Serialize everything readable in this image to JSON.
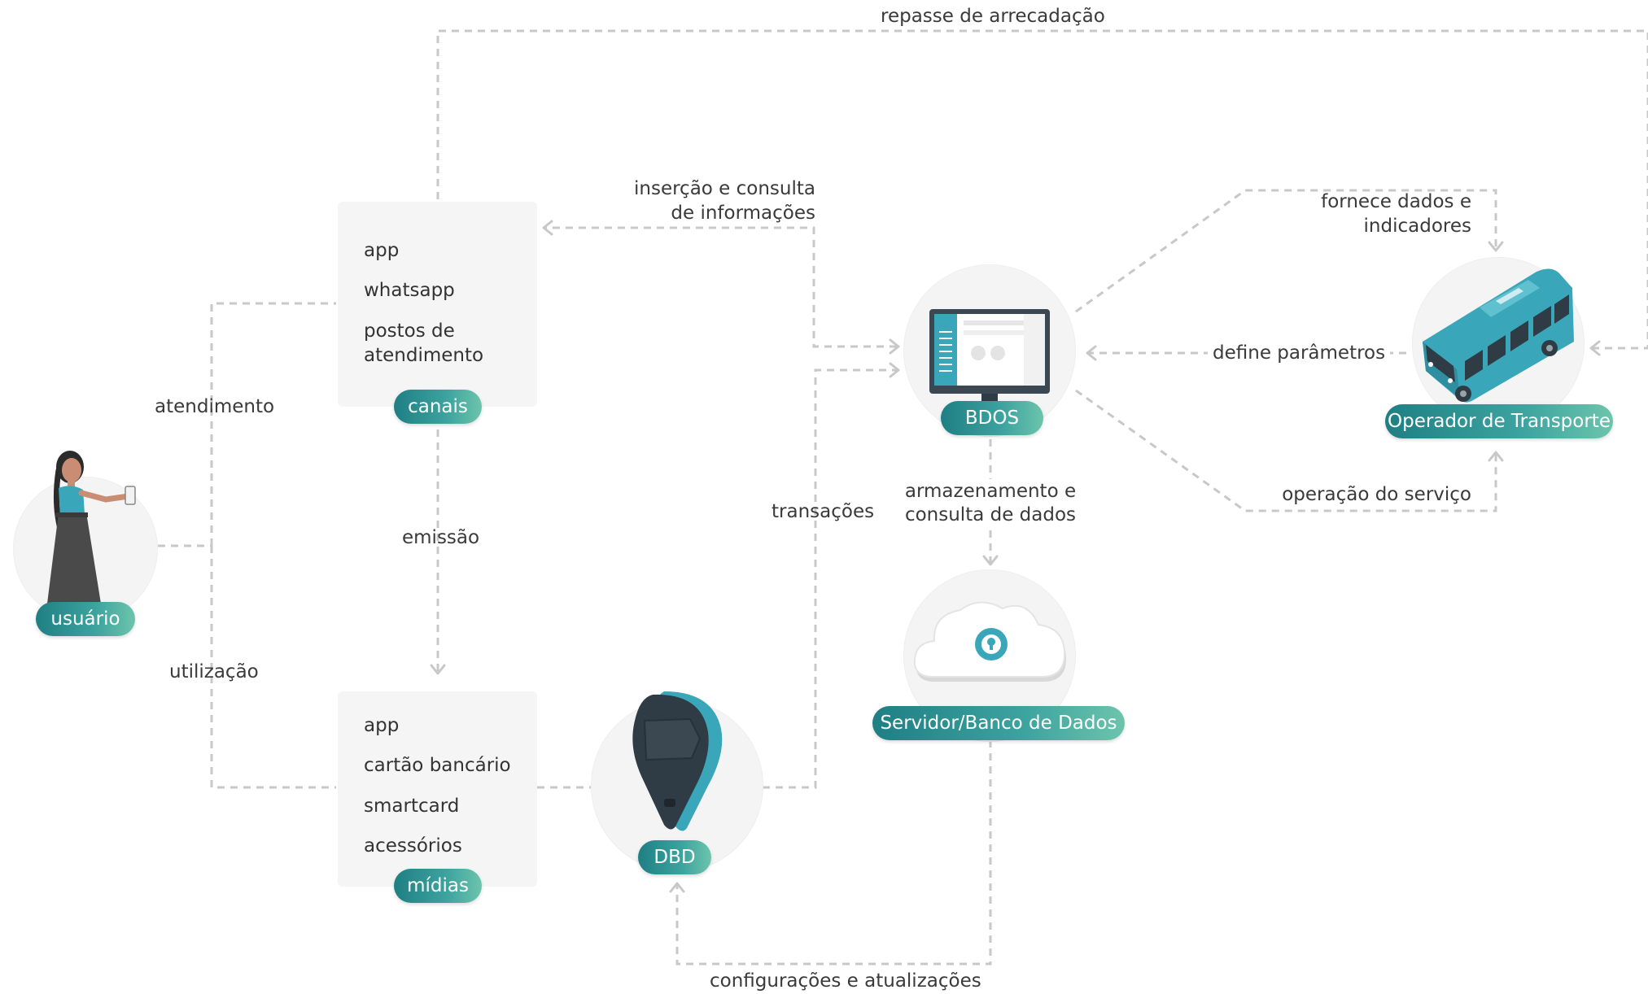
{
  "nodes": {
    "usuario": {
      "label": "usuário",
      "icon": "woman-with-phone-icon"
    },
    "canais": {
      "label": "canais",
      "items": [
        "app",
        "whatsapp",
        "postos de",
        "atendimento"
      ]
    },
    "midias": {
      "label": "mídias",
      "items": [
        "app",
        "cartão bancário",
        "smartcard",
        "acessórios"
      ]
    },
    "dbd": {
      "label": "DBD",
      "icon": "validator-device-icon"
    },
    "bdos": {
      "label": "BDOS",
      "icon": "monitor-icon"
    },
    "servidor": {
      "label": "Servidor/Banco de Dados",
      "icon": "cloud-icon"
    },
    "operador": {
      "label": "Operador de Transporte",
      "icon": "bus-icon"
    }
  },
  "edges": {
    "repasse": "repasse de arrecadação",
    "insercao_1": "inserção e consulta",
    "insercao_2": "de informações",
    "atendimento": "atendimento",
    "utilizacao": "utilização",
    "emissao": "emissão",
    "transacoes": "transações",
    "fornece_1": "fornece dados e",
    "fornece_2": "indicadores",
    "define": "define parâmetros",
    "operacao": "operação do serviço",
    "armazenamento_1": "armazenamento e",
    "armazenamento_2": "consulta de dados",
    "configuracoes": "configurações e atualizações"
  },
  "colors": {
    "pill_start": "#1f7f84",
    "pill_end": "#6cc4ac",
    "line": "#c8c8c8",
    "teal": "#3aa6b9",
    "dark": "#2f3b45"
  }
}
